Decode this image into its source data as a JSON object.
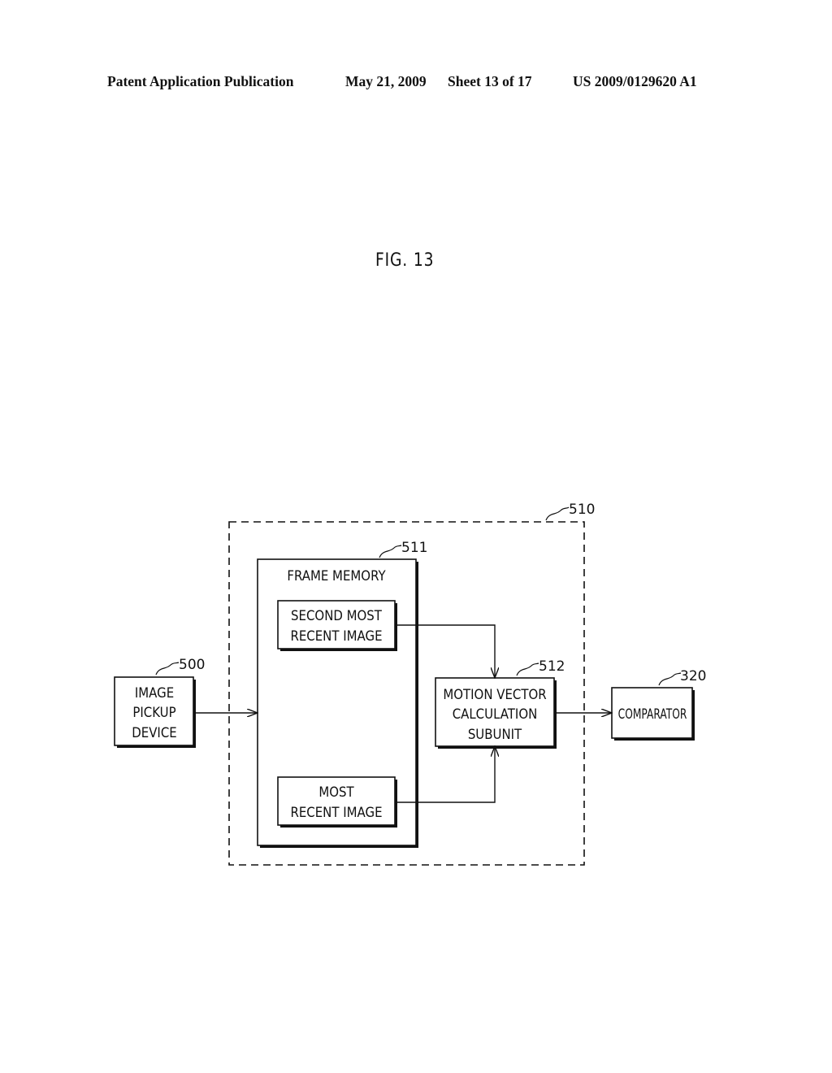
{
  "header": {
    "publication": "Patent Application Publication",
    "date": "May 21, 2009",
    "sheet": "Sheet 13 of 17",
    "number": "US 2009/0129620 A1"
  },
  "figure": {
    "title": "FIG. 13"
  },
  "diagram": {
    "nodes": {
      "unit_510": {
        "ref": "510",
        "label": "",
        "style": "dashed"
      },
      "frame_memory": {
        "ref": "511",
        "label": "FRAME MEMORY"
      },
      "second_most_recent": {
        "lines": [
          "SECOND MOST",
          "RECENT IMAGE"
        ]
      },
      "most_recent": {
        "lines": [
          "MOST",
          "RECENT IMAGE"
        ]
      },
      "image_pickup": {
        "ref": "500",
        "lines": [
          "IMAGE",
          "PICKUP",
          "DEVICE"
        ]
      },
      "motion_vector": {
        "ref": "512",
        "lines": [
          "MOTION VECTOR",
          "CALCULATION",
          "SUBUNIT"
        ]
      },
      "comparator": {
        "ref": "320",
        "lines": [
          "COMPARATOR"
        ]
      }
    },
    "edges": [
      {
        "from": "image_pickup",
        "to": "frame_memory"
      },
      {
        "from": "second_most_recent",
        "to": "motion_vector"
      },
      {
        "from": "most_recent",
        "to": "motion_vector"
      },
      {
        "from": "motion_vector",
        "to": "comparator"
      }
    ]
  }
}
